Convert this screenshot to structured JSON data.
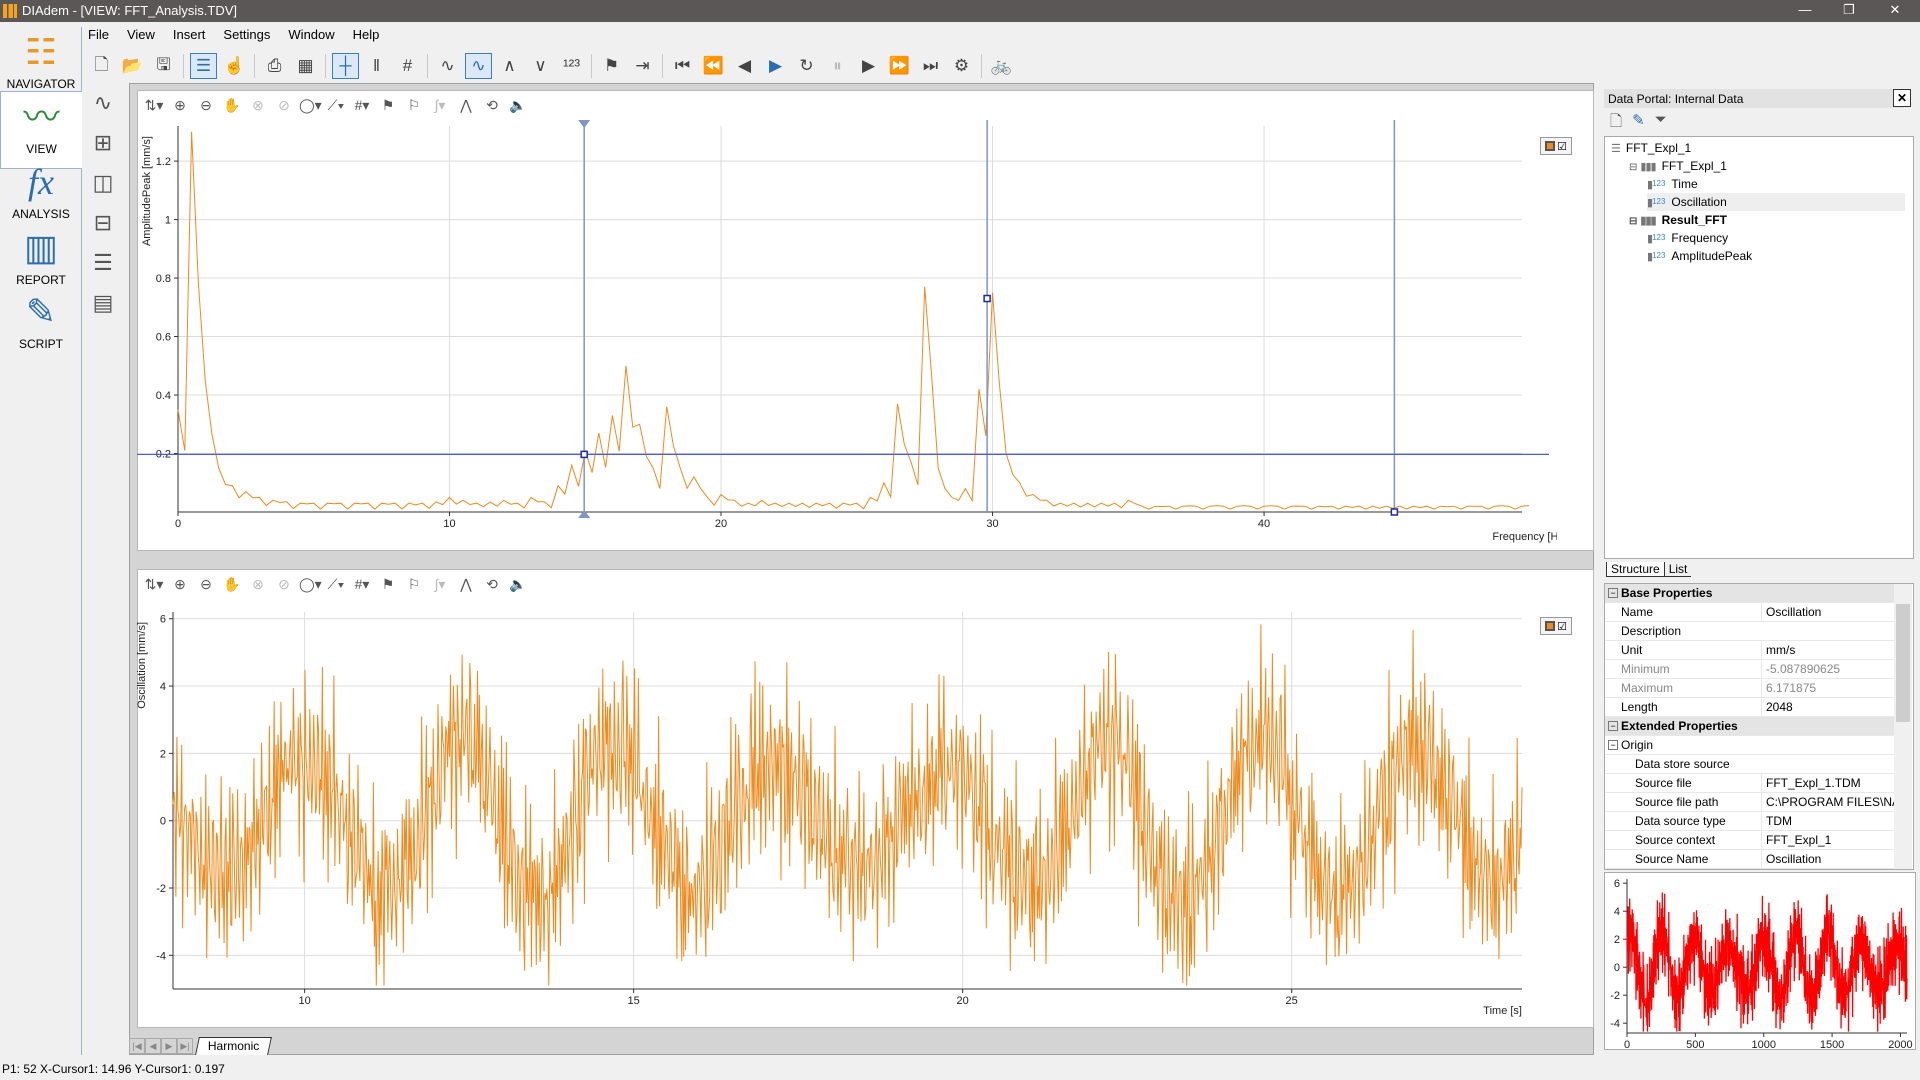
{
  "window": {
    "title": "DIAdem - [VIEW:  FFT_Analysis.TDV]",
    "minimize": "—",
    "restore": "❐",
    "close": "✕"
  },
  "menu": [
    "File",
    "View",
    "Insert",
    "Settings",
    "Window",
    "Help"
  ],
  "nav": [
    {
      "label": "NAVIGATOR",
      "icon": "navigator-icon",
      "glyph": "☷"
    },
    {
      "label": "VIEW",
      "icon": "view-icon",
      "glyph": "〰"
    },
    {
      "label": "ANALYSIS",
      "icon": "analysis-icon",
      "glyph": "fx"
    },
    {
      "label": "REPORT",
      "icon": "report-icon",
      "glyph": "▥"
    },
    {
      "label": "SCRIPT",
      "icon": "script-icon",
      "glyph": "✎"
    }
  ],
  "toolbar": [
    {
      "icon": "new-icon",
      "glyph": "🗋"
    },
    {
      "icon": "open-icon",
      "glyph": "📂"
    },
    {
      "icon": "save-icon",
      "glyph": "🖫"
    },
    {
      "icon": "data-portal-icon",
      "glyph": "☰",
      "active": true
    },
    {
      "icon": "touch-icon",
      "glyph": "☝",
      "disabled": true
    },
    {
      "icon": "print-icon",
      "glyph": "⎙"
    },
    {
      "icon": "calculator-icon",
      "glyph": "▦"
    },
    {
      "icon": "crosshair-cursor-icon",
      "glyph": "┼",
      "active": true
    },
    {
      "icon": "band-cursor-icon",
      "glyph": "‖"
    },
    {
      "icon": "frame-cursor-icon",
      "glyph": "#"
    },
    {
      "icon": "cursor-point-icon",
      "glyph": "∿"
    },
    {
      "icon": "cursor-point-active-icon",
      "glyph": "∿",
      "active": true
    },
    {
      "icon": "peak-cursor-icon",
      "glyph": "∧"
    },
    {
      "icon": "valley-cursor-icon",
      "glyph": "∨"
    },
    {
      "icon": "value-display-icon",
      "glyph": "¹²³"
    },
    {
      "icon": "flag-delete-icon",
      "glyph": "⚑"
    },
    {
      "icon": "export-icon",
      "glyph": "⇥"
    },
    {
      "icon": "first-icon",
      "glyph": "⏮"
    },
    {
      "icon": "fast-back-icon",
      "glyph": "⏪"
    },
    {
      "icon": "step-back-icon",
      "glyph": "◀"
    },
    {
      "icon": "play-icon",
      "glyph": "▶",
      "blue": true
    },
    {
      "icon": "loop-icon",
      "glyph": "↻"
    },
    {
      "icon": "pause-icon",
      "glyph": "⏸",
      "disabled": true
    },
    {
      "icon": "step-forward-icon",
      "glyph": "▶"
    },
    {
      "icon": "fast-forward-icon",
      "glyph": "⏩"
    },
    {
      "icon": "last-icon",
      "glyph": "⏭"
    },
    {
      "icon": "player-settings-icon",
      "glyph": "⚙"
    },
    {
      "icon": "bike-icon",
      "glyph": "🚲"
    }
  ],
  "chart_toolbar": [
    {
      "icon": "cursor-select-icon",
      "glyph": "⇅▾"
    },
    {
      "icon": "zoom-in-icon",
      "glyph": "⊕"
    },
    {
      "icon": "zoom-out-icon",
      "glyph": "⊖"
    },
    {
      "icon": "pan-icon",
      "glyph": "✋"
    },
    {
      "icon": "zoom-reset-icon",
      "glyph": "⊗",
      "disabled": true
    },
    {
      "icon": "zoom-back-icon",
      "glyph": "⊘",
      "disabled": true
    },
    {
      "icon": "curve-style-icon",
      "glyph": "◯▾"
    },
    {
      "icon": "axis-icon",
      "glyph": "⟋▾"
    },
    {
      "icon": "grid-icon",
      "glyph": "#▾"
    },
    {
      "icon": "flag-add-icon",
      "glyph": "⚑"
    },
    {
      "icon": "flag-remove-icon",
      "glyph": "⚐"
    },
    {
      "icon": "curve-edit-icon",
      "glyph": "∫▾",
      "disabled": true
    },
    {
      "icon": "curve-points-icon",
      "glyph": "⋀"
    },
    {
      "icon": "sync-icon",
      "glyph": "⟲"
    },
    {
      "icon": "sound-icon",
      "glyph": "🔈",
      "disabled": true
    }
  ],
  "colors": {
    "curve": "#f08a1c",
    "cursor": "#7e95c8",
    "cursor_hline": "#4f5bd5",
    "mini_curve": "#ff0000",
    "grid": "#dcdcdc"
  },
  "chart_data": [
    {
      "type": "line",
      "xlabel": "Frequency [Hz]",
      "ylabel": "AmplitudePeak [mm/s]",
      "xlim": [
        0,
        49.5
      ],
      "ylim": [
        0,
        1.32
      ],
      "xticks": [
        0,
        10,
        20,
        30,
        40
      ],
      "yticks": [
        0.2,
        0.4,
        0.6,
        0.8,
        1,
        1.2
      ],
      "grid": true,
      "x_step": 0.5,
      "values": [
        0.35,
        1.3,
        0.45,
        0.15,
        0.09,
        0.07,
        0.05,
        0.04,
        0.035,
        0.03,
        0.03,
        0.03,
        0.03,
        0.03,
        0.03,
        0.03,
        0.03,
        0.03,
        0.03,
        0.035,
        0.05,
        0.04,
        0.03,
        0.035,
        0.04,
        0.03,
        0.05,
        0.035,
        0.09,
        0.16,
        0.21,
        0.27,
        0.33,
        0.5,
        0.3,
        0.15,
        0.36,
        0.15,
        0.12,
        0.05,
        0.06,
        0.04,
        0.03,
        0.04,
        0.03,
        0.03,
        0.03,
        0.03,
        0.03,
        0.03,
        0.03,
        0.05,
        0.1,
        0.37,
        0.17,
        0.77,
        0.15,
        0.05,
        0.08,
        0.42,
        0.75,
        0.2,
        0.1,
        0.06,
        0.04,
        0.03,
        0.03,
        0.03,
        0.03,
        0.03,
        0.04,
        0.02,
        0.02,
        0.02,
        0.02,
        0.02,
        0.02,
        0.02,
        0.02,
        0.02,
        0.02,
        0.02,
        0.02,
        0.02,
        0.02,
        0.02,
        0.02,
        0.02,
        0.02,
        0.02,
        0.02,
        0.02,
        0.02,
        0.02,
        0.02,
        0.02,
        0.02,
        0.02,
        0.02,
        0.02
      ],
      "cursors": {
        "vertical": [
          14.96,
          29.8,
          44.8
        ],
        "horizontal": 0.197,
        "markers": [
          [
            14.96,
            0.197
          ],
          [
            29.8,
            0.73
          ],
          [
            44.8,
            0.0
          ]
        ]
      }
    },
    {
      "type": "line",
      "xlabel": "Time [s]",
      "ylabel": "Oscillation [mm/s]",
      "xlim": [
        8,
        28.5
      ],
      "ylim": [
        -5.0,
        6.2
      ],
      "xticks": [
        10,
        15,
        20,
        25
      ],
      "yticks": [
        -4,
        -2,
        0,
        2,
        4,
        6
      ],
      "grid": true
    },
    {
      "type": "line",
      "xlim": [
        0,
        2048
      ],
      "ylim": [
        -4.7,
        6.3
      ],
      "xticks": [
        0,
        500,
        1000,
        1500,
        2000
      ],
      "yticks": [
        -4,
        -2,
        0,
        2,
        4,
        6
      ],
      "grid": false
    }
  ],
  "sheet_tab": "Harmonic",
  "status": "P1: 52 X-Cursor1: 14.96 Y-Cursor1: 0.197",
  "portal": {
    "title": "Data Portal: Internal Data",
    "tree": [
      {
        "label": "FFT_Expl_1",
        "level": 0,
        "kind": "file"
      },
      {
        "label": "FFT_Expl_1",
        "level": 1,
        "kind": "group"
      },
      {
        "label": "Time",
        "level": 2,
        "kind": "channel"
      },
      {
        "label": "Oscillation",
        "level": 2,
        "kind": "channel",
        "selected": true
      },
      {
        "label": "Result_FFT",
        "level": 1,
        "kind": "group",
        "bold": true
      },
      {
        "label": "Frequency",
        "level": 2,
        "kind": "channel"
      },
      {
        "label": "AmplitudePeak",
        "level": 2,
        "kind": "channel"
      }
    ],
    "tabs": [
      "Structure",
      "List"
    ],
    "properties": [
      {
        "group": "Base Properties"
      },
      {
        "key": "Name",
        "value": "Oscillation"
      },
      {
        "key": "Description",
        "value": ""
      },
      {
        "key": "Unit",
        "value": "mm/s"
      },
      {
        "key": "Minimum",
        "value": "-5.087890625",
        "muted": true
      },
      {
        "key": "Maximum",
        "value": "6.171875",
        "muted": true
      },
      {
        "key": "Length",
        "value": "2048"
      },
      {
        "group": "Extended Properties"
      },
      {
        "subgroup": "Origin"
      },
      {
        "key": "Data store source",
        "value": "",
        "indent": true
      },
      {
        "key": "Source file",
        "value": "FFT_Expl_1.TDM",
        "indent": true
      },
      {
        "key": "Source file path",
        "value": "C:\\PROGRAM FILES\\NA...",
        "indent": true
      },
      {
        "key": "Data source type",
        "value": "TDM",
        "indent": true
      },
      {
        "key": "Source context",
        "value": "FFT_Expl_1",
        "indent": true
      },
      {
        "key": "Source Name",
        "value": "Oscillation",
        "indent": true
      }
    ]
  }
}
